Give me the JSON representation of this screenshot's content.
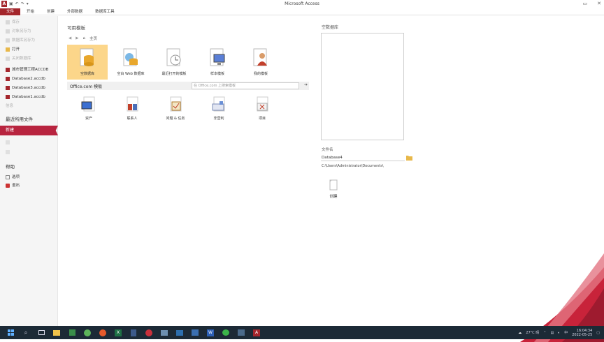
{
  "window": {
    "title": "Microsoft Access",
    "controls": [
      "▭",
      "✕"
    ]
  },
  "ribbon": {
    "tabs": [
      "文件",
      "开始",
      "创建",
      "外部数据",
      "数据库工具"
    ]
  },
  "leftnav": {
    "items": [
      "保存",
      "对象另存为",
      "数据库另存为",
      "打开",
      "关闭数据库"
    ],
    "recent": [
      "城市管理工程ACCDB",
      "Database2.accdb",
      "Database3.accdb",
      "Database1.accdb"
    ],
    "info_label": "信息",
    "section_heading": "最近所用文件",
    "selected": "新建",
    "help_heading": "帮助",
    "bottom_items": [
      "选项",
      "退出"
    ]
  },
  "main": {
    "heading": "可用模板",
    "breadcrumb_home": "主页",
    "templates": [
      {
        "label": "空数据库",
        "icon": "blank-database-icon"
      },
      {
        "label": "空白 Web 数据库",
        "icon": "blank-web-database-icon"
      },
      {
        "label": "最近打开的模板",
        "icon": "recent-templates-icon"
      },
      {
        "label": "样本模板",
        "icon": "sample-templates-icon"
      },
      {
        "label": "我的模板",
        "icon": "my-templates-icon"
      }
    ],
    "office_bar_title": "Office.com 模板",
    "office_search_placeholder": "在 Office.com 上搜索模板",
    "office_templates": [
      {
        "label": "资产",
        "icon": "assets-icon"
      },
      {
        "label": "联系人",
        "icon": "contacts-icon"
      },
      {
        "label": "问题 & 任务",
        "icon": "issues-tasks-icon"
      },
      {
        "label": "非营利",
        "icon": "nonprofit-icon"
      },
      {
        "label": "项目",
        "icon": "projects-icon"
      }
    ]
  },
  "right": {
    "heading": "空数据库",
    "filename_label": "文件名",
    "filename_value": "Database4",
    "path": "C:\\Users\\Administrator\\Documents\\",
    "create_label": "创建"
  },
  "taskbar": {
    "tray_text": "27°C 晴",
    "time": "16:04:34",
    "date": "2022-05-25"
  },
  "colors": {
    "accent": "#a4262c",
    "selected_nav": "#b8243f",
    "highlight_template": "#fcd68a",
    "taskbar": "#1c2a36"
  }
}
